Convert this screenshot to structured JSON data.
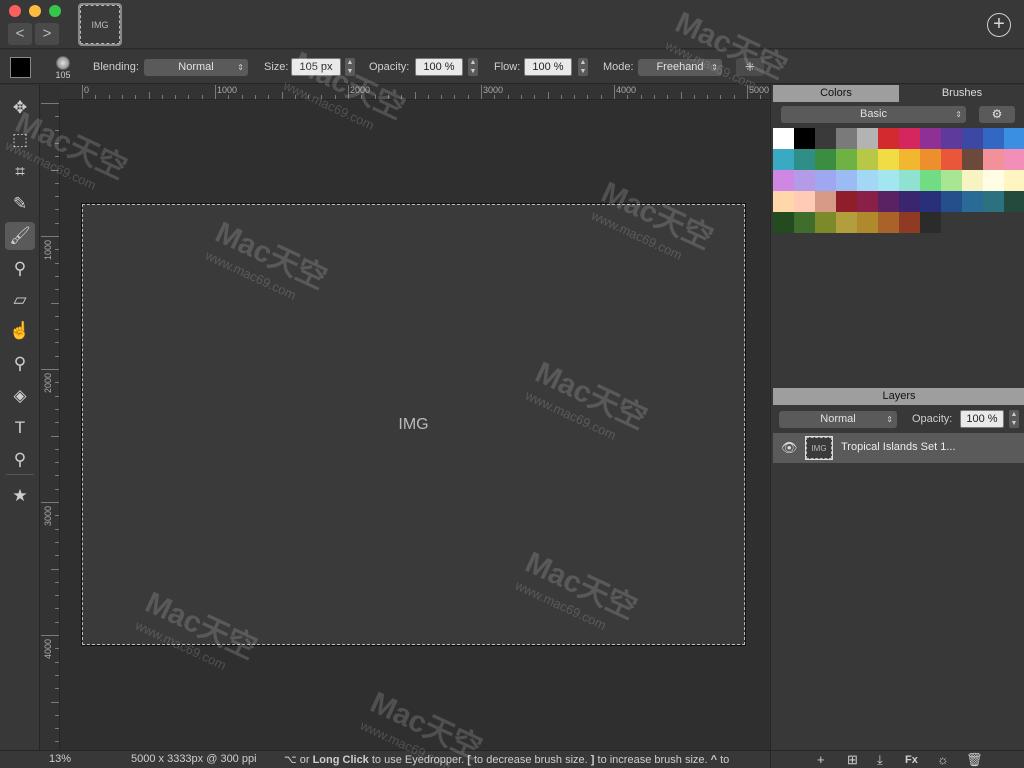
{
  "window": {
    "document_thumb": "Tropical Islands Set 1"
  },
  "nav": {
    "back": "<",
    "forward": ">",
    "add": "+"
  },
  "options": {
    "brush_size_preview": "105",
    "blending_label": "Blending:",
    "blending_value": "Normal",
    "size_label": "Size:",
    "size_value": "105 px",
    "opacity_label": "Opacity:",
    "opacity_value": "100 %",
    "flow_label": "Flow:",
    "flow_value": "100 %",
    "mode_label": "Mode:",
    "mode_value": "Freehand"
  },
  "tools": [
    {
      "name": "move-tool",
      "glyph": "✥"
    },
    {
      "name": "marquee-tool",
      "glyph": "⬚"
    },
    {
      "name": "crop-tool",
      "glyph": "⌗"
    },
    {
      "name": "eyedropper-tool",
      "glyph": "✎"
    },
    {
      "name": "brush-tool",
      "glyph": "🖌",
      "active": true
    },
    {
      "name": "clone-stamp-tool",
      "glyph": "⚲"
    },
    {
      "name": "eraser-tool",
      "glyph": "▱"
    },
    {
      "name": "smudge-tool",
      "glyph": "☝"
    },
    {
      "name": "dodge-tool",
      "glyph": "⚲"
    },
    {
      "name": "paint-bucket-tool",
      "glyph": "◈"
    },
    {
      "name": "text-tool",
      "glyph": "T"
    },
    {
      "name": "zoom-tool",
      "glyph": "⚲"
    },
    {
      "name": "favorites-tool",
      "glyph": "★"
    }
  ],
  "ruler": {
    "top": [
      "0",
      "1000",
      "2000",
      "3000",
      "4000",
      "5000"
    ],
    "left": [
      "1000",
      "2000",
      "3000",
      "4000"
    ]
  },
  "panels": {
    "colors_tab": "Colors",
    "brushes_tab": "Brushes",
    "palette_value": "Basic",
    "swatch_colors": [
      "#ffffff",
      "#000000",
      "#3a3a3a",
      "#7a7a7a",
      "#b3b3b3",
      "#d32a2f",
      "#d6265f",
      "#8e3096",
      "#5d3a9c",
      "#3c48a3",
      "#3268c4",
      "#3a8fe3",
      "#3aa9c2",
      "#2f8f86",
      "#3b8e3f",
      "#6fb244",
      "#b6c845",
      "#f0dd45",
      "#f1b731",
      "#ee8f2e",
      "#e9563a",
      "#6b4a3c",
      "#f3919b",
      "#f18fb8",
      "#cf87e3",
      "#b49be8",
      "#9fa7f0",
      "#9bbcf2",
      "#a3d8f4",
      "#a2e7ef",
      "#8ee2cf",
      "#72dc85",
      "#a8e693",
      "#f7f3c3",
      "#fffde3",
      "#fff5c0",
      "#ffd7a8",
      "#ffcbb6",
      "#d69a86",
      "#8f1e2b",
      "#8a1f47",
      "#5a2263",
      "#3a2670",
      "#2a2f7a",
      "#244f8a",
      "#2a6a96",
      "#2b7180",
      "#244a3d",
      "#244a1f",
      "#3f6e2c",
      "#7c8a2a",
      "#b09f3c",
      "#b0892d",
      "#a9622a",
      "#8f3a23",
      "#2b2b2b"
    ],
    "layers_head": "Layers",
    "layer_blend": "Normal",
    "layer_opacity_label": "Opacity:",
    "layer_opacity": "100 %",
    "layer_name": "Tropical Islands Set 1..."
  },
  "status": {
    "zoom": "13%",
    "doc_info": "5000 x 3333px @ 300 ppi",
    "hint_a": "⌥ or ",
    "hint_b": "Long Click",
    "hint_c": " to use Eyedropper. ",
    "hint_d": "[",
    "hint_e": " to decrease brush size. ",
    "hint_f": "]",
    "hint_g": " to increase brush size. ",
    "hint_h": "^",
    "hint_i": " to"
  },
  "layer_tools": {
    "add": "+",
    "new_layer": "⊞",
    "merge": "⤓",
    "fx": "Fx",
    "adjust": "☼",
    "delete": "🗑"
  },
  "watermark": {
    "text": "Mac天空",
    "url": "www.mac69.com"
  }
}
